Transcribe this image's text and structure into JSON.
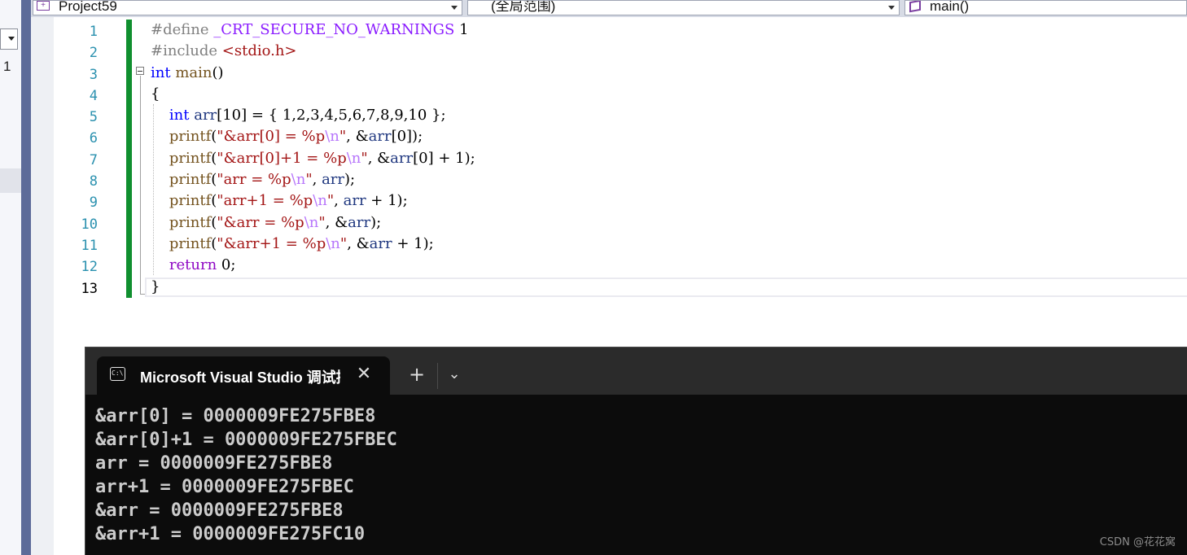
{
  "left_panel": {
    "text": "1"
  },
  "navbar": {
    "project": "Project59",
    "scope": "(全局范围)",
    "member": "main()"
  },
  "editor": {
    "line_numbers": [
      "1",
      "2",
      "3",
      "4",
      "5",
      "6",
      "7",
      "8",
      "9",
      "10",
      "11",
      "12",
      "13"
    ],
    "code": [
      [
        {
          "t": "#define ",
          "c": "pp"
        },
        {
          "t": "_CRT_SECURE_NO_WARNINGS",
          "c": "mac"
        },
        {
          "t": " 1",
          "c": ""
        }
      ],
      [
        {
          "t": "#include ",
          "c": "pp"
        },
        {
          "t": "<stdio.h>",
          "c": "str"
        }
      ],
      [
        {
          "t": "int",
          "c": "kw"
        },
        {
          "t": " ",
          "c": ""
        },
        {
          "t": "main",
          "c": "fn"
        },
        {
          "t": "()",
          "c": ""
        }
      ],
      [
        {
          "t": "{",
          "c": ""
        }
      ],
      [
        {
          "t": "    ",
          "c": ""
        },
        {
          "t": "int",
          "c": "kw"
        },
        {
          "t": " ",
          "c": ""
        },
        {
          "t": "arr",
          "c": "var"
        },
        {
          "t": "[10] = { 1,2,3,4,5,6,7,8,9,10 };",
          "c": ""
        }
      ],
      [
        {
          "t": "    ",
          "c": ""
        },
        {
          "t": "printf",
          "c": "fn"
        },
        {
          "t": "(",
          "c": ""
        },
        {
          "t": "\"&arr[0] = %p",
          "c": "str"
        },
        {
          "t": "\\n",
          "c": "esc"
        },
        {
          "t": "\"",
          "c": "str"
        },
        {
          "t": ", &",
          "c": ""
        },
        {
          "t": "arr",
          "c": "var"
        },
        {
          "t": "[0]);",
          "c": ""
        }
      ],
      [
        {
          "t": "    ",
          "c": ""
        },
        {
          "t": "printf",
          "c": "fn"
        },
        {
          "t": "(",
          "c": ""
        },
        {
          "t": "\"&arr[0]+1 = %p",
          "c": "str"
        },
        {
          "t": "\\n",
          "c": "esc"
        },
        {
          "t": "\"",
          "c": "str"
        },
        {
          "t": ", &",
          "c": ""
        },
        {
          "t": "arr",
          "c": "var"
        },
        {
          "t": "[0] + 1);",
          "c": ""
        }
      ],
      [
        {
          "t": "    ",
          "c": ""
        },
        {
          "t": "printf",
          "c": "fn"
        },
        {
          "t": "(",
          "c": ""
        },
        {
          "t": "\"arr = %p",
          "c": "str"
        },
        {
          "t": "\\n",
          "c": "esc"
        },
        {
          "t": "\"",
          "c": "str"
        },
        {
          "t": ", ",
          "c": ""
        },
        {
          "t": "arr",
          "c": "var"
        },
        {
          "t": ");",
          "c": ""
        }
      ],
      [
        {
          "t": "    ",
          "c": ""
        },
        {
          "t": "printf",
          "c": "fn"
        },
        {
          "t": "(",
          "c": ""
        },
        {
          "t": "\"arr+1 = %p",
          "c": "str"
        },
        {
          "t": "\\n",
          "c": "esc"
        },
        {
          "t": "\"",
          "c": "str"
        },
        {
          "t": ", ",
          "c": ""
        },
        {
          "t": "arr",
          "c": "var"
        },
        {
          "t": " + 1);",
          "c": ""
        }
      ],
      [
        {
          "t": "    ",
          "c": ""
        },
        {
          "t": "printf",
          "c": "fn"
        },
        {
          "t": "(",
          "c": ""
        },
        {
          "t": "\"&arr = %p",
          "c": "str"
        },
        {
          "t": "\\n",
          "c": "esc"
        },
        {
          "t": "\"",
          "c": "str"
        },
        {
          "t": ", &",
          "c": ""
        },
        {
          "t": "arr",
          "c": "var"
        },
        {
          "t": ");",
          "c": ""
        }
      ],
      [
        {
          "t": "    ",
          "c": ""
        },
        {
          "t": "printf",
          "c": "fn"
        },
        {
          "t": "(",
          "c": ""
        },
        {
          "t": "\"&arr+1 = %p",
          "c": "str"
        },
        {
          "t": "\\n",
          "c": "esc"
        },
        {
          "t": "\"",
          "c": "str"
        },
        {
          "t": ", &",
          "c": ""
        },
        {
          "t": "arr",
          "c": "var"
        },
        {
          "t": " + 1);",
          "c": ""
        }
      ],
      [
        {
          "t": "    ",
          "c": ""
        },
        {
          "t": "return",
          "c": "ctl"
        },
        {
          "t": " 0;",
          "c": ""
        }
      ],
      [
        {
          "t": "}",
          "c": ""
        }
      ]
    ]
  },
  "console": {
    "tab_title": "Microsoft Visual Studio 调试控制台",
    "tab_icon_text": "C:\\",
    "close_glyph": "✕",
    "new_tab_glyph": "+",
    "dropdown_glyph": "⌄",
    "lines": [
      "&arr[0] = 0000009FE275FBE8",
      "&arr[0]+1 = 0000009FE275FBEC",
      "arr = 0000009FE275FBE8",
      "arr+1 = 0000009FE275FBEC",
      "&arr = 0000009FE275FBE8",
      "&arr+1 = 0000009FE275FC10"
    ]
  },
  "watermark": "CSDN @花花窝"
}
